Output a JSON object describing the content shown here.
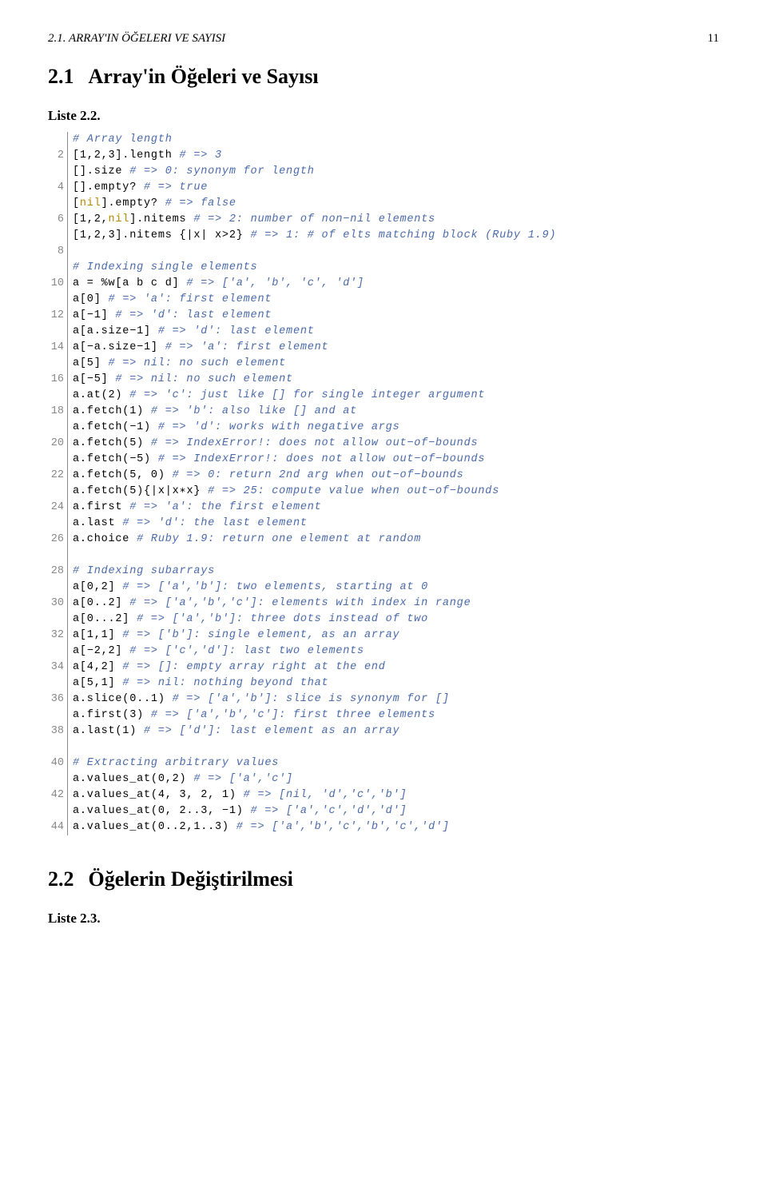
{
  "header": {
    "left": "2.1. ARRAY'IN ÖĞELERI VE SAYISI",
    "page": "11"
  },
  "sec21": {
    "num": "2.1",
    "title": "Array'in Öğeleri ve Sayısı"
  },
  "liste22": "Liste 2.2.",
  "sec22": {
    "num": "2.2",
    "title": "Öğelerin Değiştirilmesi"
  },
  "liste23": "Liste 2.3.",
  "gutter_numbers": [
    "",
    "2",
    "",
    "4",
    "",
    "6",
    "",
    "8",
    "",
    "10",
    "",
    "12",
    "",
    "14",
    "",
    "16",
    "",
    "18",
    "",
    "20",
    "",
    "22",
    "",
    "24",
    "",
    "26",
    "",
    "28",
    "",
    "30",
    "",
    "32",
    "",
    "34",
    "",
    "36",
    "",
    "38",
    "",
    "40",
    "",
    "42",
    "",
    "44"
  ],
  "code": {
    "l1_c": "# Array length",
    "l2a": "[1,2,3].length ",
    "l2_c": "# => 3",
    "l3a": "[].size ",
    "l3_c": "# => 0: synonym for length",
    "l4a": "[].empty? ",
    "l4_c": "# => true",
    "l5a": "[",
    "l5_nil": "nil",
    "l5b": "].empty? ",
    "l5_c": "# => false",
    "l6a": "[1,2,",
    "l6_nil": "nil",
    "l6b": "].nitems ",
    "l6_c": "# => 2: number of non−nil elements",
    "l7a": "[1,2,3].nitems {|x| x>2} ",
    "l7_c": "# => 1: # of elts matching block (Ruby 1.9)",
    "l9_c": "# Indexing single elements",
    "l10a": "a = %w[a b c d] ",
    "l10_c": "# => ['a', 'b', 'c', 'd']",
    "l11a": "a[0] ",
    "l11_c": "# => 'a': first element",
    "l12a": "a[−1] ",
    "l12_c": "# => 'd': last element",
    "l13a": "a[a.size−1] ",
    "l13_c": "# => 'd': last element",
    "l14a": "a[−a.size−1] ",
    "l14_c": "# => 'a': first element",
    "l15a": "a[5] ",
    "l15_c": "# => nil: no such element",
    "l16a": "a[−5] ",
    "l16_c": "# => nil: no such element",
    "l17a": "a.at(2) ",
    "l17_c": "# => 'c': just like [] for single integer argument",
    "l18a": "a.fetch(1) ",
    "l18_c": "# => 'b': also like [] and at",
    "l19a": "a.fetch(−1) ",
    "l19_c": "# => 'd': works with negative args",
    "l20a": "a.fetch(5) ",
    "l20_c": "# => IndexError!: does not allow out−of−bounds",
    "l21a": "a.fetch(−5) ",
    "l21_c": "# => IndexError!: does not allow out−of−bounds",
    "l22a": "a.fetch(5, 0) ",
    "l22_c": "# => 0: return 2nd arg when out−of−bounds",
    "l23a": "a.fetch(5){|x|x∗x} ",
    "l23_c": "# => 25: compute value when out−of−bounds",
    "l24a": "a.first ",
    "l24_c": "# => 'a': the first element",
    "l25a": "a.last ",
    "l25_c": "# => 'd': the last element",
    "l26a": "a.choice ",
    "l26_c": "# Ruby 1.9: return one element at random",
    "l28_c": "# Indexing subarrays",
    "l29a": "a[0,2] ",
    "l29_c": "# => ['a','b']: two elements, starting at 0",
    "l30a": "a[0..2] ",
    "l30_c": "# => ['a','b','c']: elements with index in range",
    "l31a": "a[0...2] ",
    "l31_c": "# => ['a','b']: three dots instead of two",
    "l32a": "a[1,1] ",
    "l32_c": "# => ['b']: single element, as an array",
    "l33a": "a[−2,2] ",
    "l33_c": "# => ['c','d']: last two elements",
    "l34a": "a[4,2] ",
    "l34_c": "# => []: empty array right at the end",
    "l35a": "a[5,1] ",
    "l35_c": "# => nil: nothing beyond that",
    "l36a": "a.slice(0..1) ",
    "l36_c": "# => ['a','b']: slice is synonym for []",
    "l37a": "a.first(3) ",
    "l37_c": "# => ['a','b','c']: first three elements",
    "l38a": "a.last(1) ",
    "l38_c": "# => ['d']: last element as an array",
    "l40_c": "# Extracting arbitrary values",
    "l41a": "a.values_at(0,2) ",
    "l41_c": "# => ['a','c']",
    "l42a": "a.values_at(4, 3, 2, 1) ",
    "l42_c": "# => [nil, 'd','c','b']",
    "l43a": "a.values_at(0, 2..3, −1) ",
    "l43_c": "# => ['a','c','d','d']",
    "l44a": "a.values_at(0..2,1..3) ",
    "l44_c": "# => ['a','b','c','b','c','d']"
  }
}
